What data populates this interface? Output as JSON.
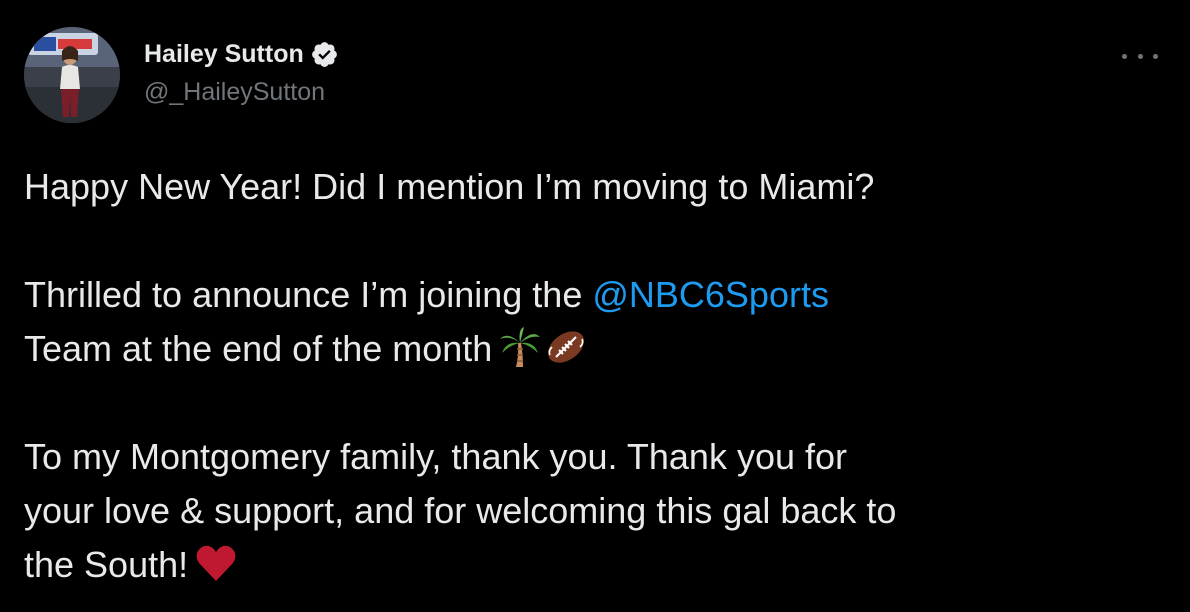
{
  "tweet": {
    "author": {
      "display_name": "Hailey Sutton",
      "handle": "@_HaileySutton",
      "verified": true,
      "avatar_icon": "profile-photo"
    },
    "more_icon": "ellipsis-icon",
    "lines": {
      "line1": "Happy New Year! Did I mention I’m moving to Miami?",
      "line2_before": "Thrilled to announce I’m joining the ",
      "line2_mention": "@NBC6Sports",
      "line3": "Team at the end of the month",
      "line3_emojis": [
        "palm-tree-emoji",
        "american-football-emoji"
      ],
      "line4": "To my Montgomery family, thank you. Thank you for",
      "line5": "your love & support, and for welcoming this gal back to",
      "line6": "the South!",
      "line6_emoji": "red-heart-emoji"
    },
    "colors": {
      "background": "#000000",
      "text": "#e7e9ea",
      "secondary": "#71767b",
      "mention": "#1d9bf0",
      "verified_badge": "#e7e9ea"
    }
  }
}
